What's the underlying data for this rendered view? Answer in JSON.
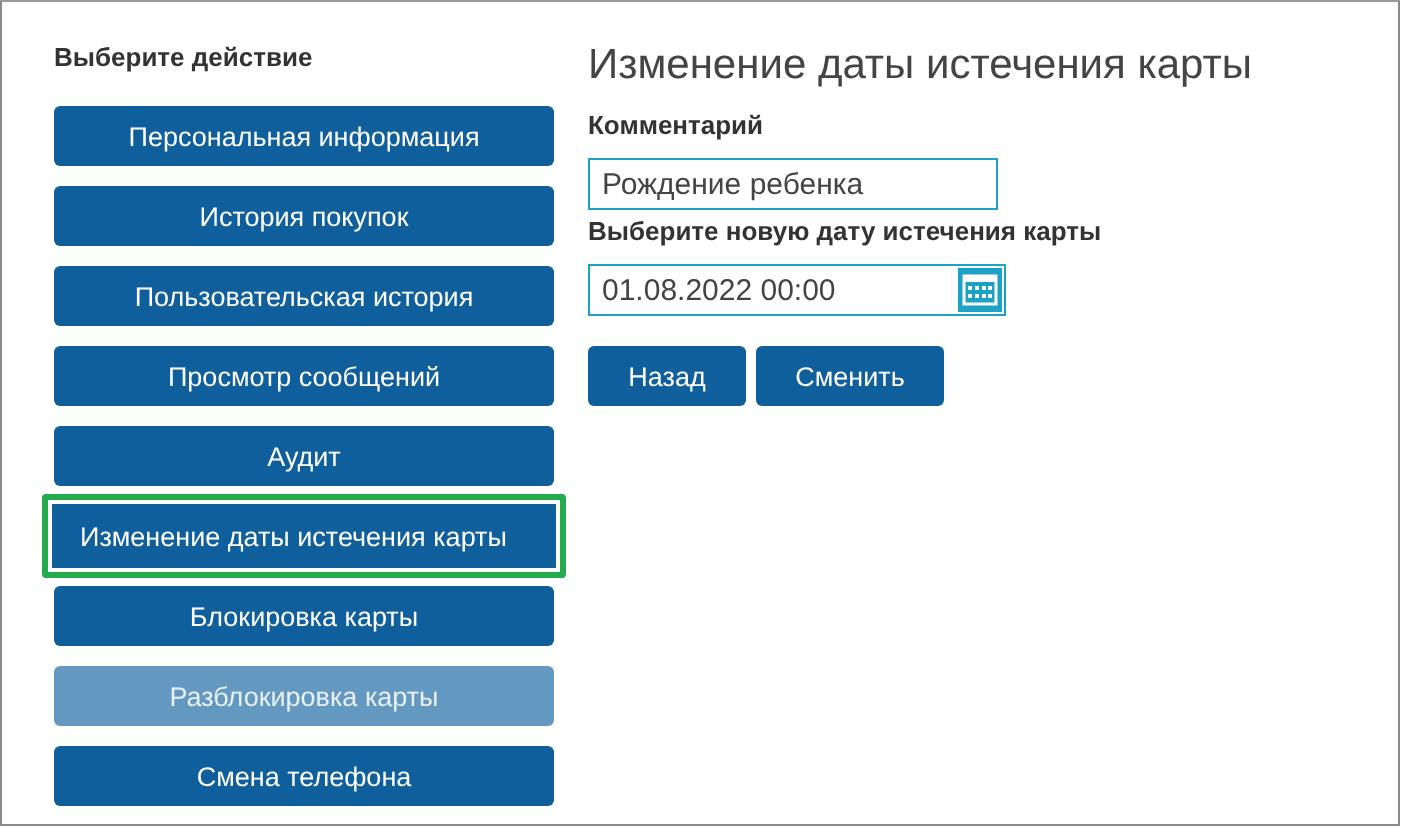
{
  "sidebar": {
    "heading": "Выберите действие",
    "items": [
      {
        "label": "Персональная информация",
        "selected": false,
        "disabled": false
      },
      {
        "label": "История покупок",
        "selected": false,
        "disabled": false
      },
      {
        "label": "Пользовательская история",
        "selected": false,
        "disabled": false
      },
      {
        "label": "Просмотр сообщений",
        "selected": false,
        "disabled": false
      },
      {
        "label": "Аудит",
        "selected": false,
        "disabled": false
      },
      {
        "label": "Изменение даты истечения карты",
        "selected": true,
        "disabled": false
      },
      {
        "label": "Блокировка карты",
        "selected": false,
        "disabled": false
      },
      {
        "label": "Разблокировка карты",
        "selected": false,
        "disabled": true
      },
      {
        "label": "Смена телефона",
        "selected": false,
        "disabled": false
      }
    ]
  },
  "form": {
    "title": "Изменение даты истечения карты",
    "comment_label": "Комментарий",
    "comment": "Рождение ребенка",
    "date_label": "Выберите новую дату истечения карты",
    "date": "01.08.2022 00:00",
    "buttons": [
      "Назад",
      "Сменить"
    ]
  }
}
